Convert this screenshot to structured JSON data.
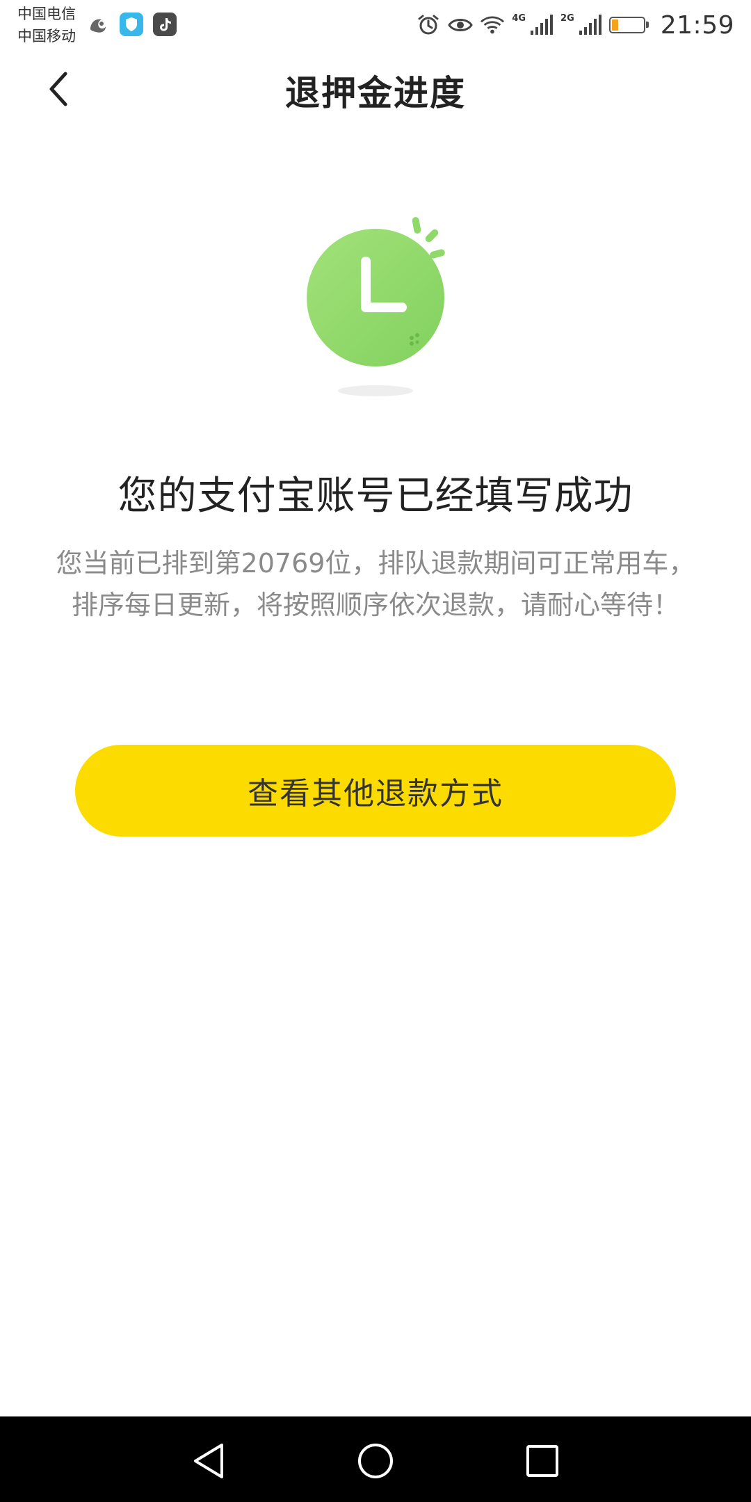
{
  "status_bar": {
    "carrier_1": "中国电信",
    "carrier_2": "中国移动",
    "network_1": "4G",
    "network_2": "2G",
    "time": "21:59",
    "battery_color": "#f7a21b"
  },
  "header": {
    "back_icon": "chevron-left-icon",
    "title": "退押金进度"
  },
  "illustration": {
    "icon": "clock-icon",
    "color": "#8fd96a"
  },
  "main": {
    "headline": "您的支付宝账号已经填写成功",
    "description_line1": "您当前已排到第20769位，排队退款期间可正常用车，",
    "description_line2": "排序每日更新，将按照顺序依次退款，请耐心等待！",
    "button_label": "查看其他退款方式",
    "button_color": "#fcdc00"
  },
  "system_nav": {
    "back": "triangle-back-icon",
    "home": "circle-home-icon",
    "recents": "square-recents-icon"
  }
}
